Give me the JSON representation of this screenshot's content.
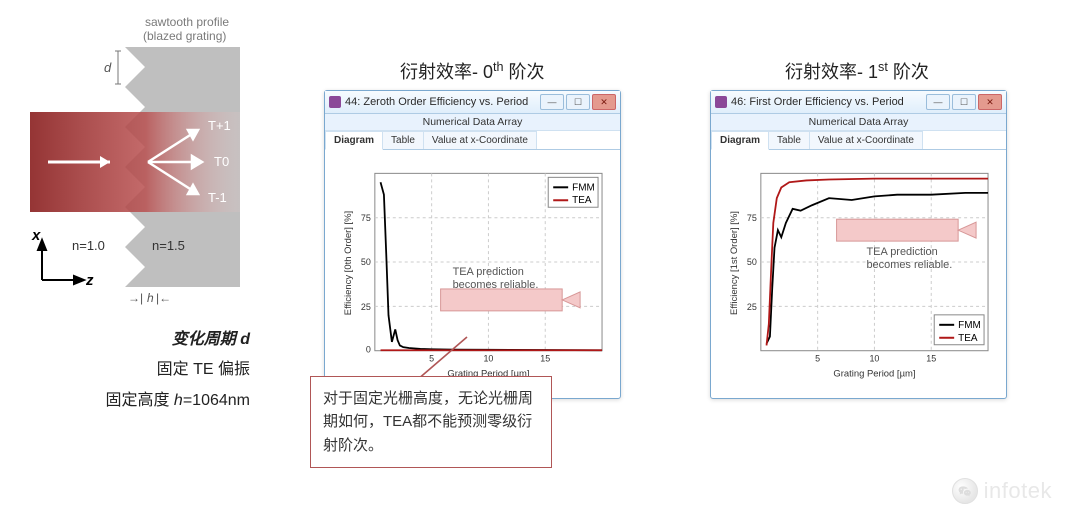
{
  "diagram": {
    "profile_label": "sawtooth profile\n(blazed grating)",
    "d": "d",
    "h": "h",
    "orders": {
      "plus": "T+1",
      "zero": "T0",
      "minus": "T-1"
    },
    "n_in": "n=1.0",
    "n_out": "n=1.5",
    "axes": {
      "x": "x",
      "z": "z"
    },
    "caption_line1_prefix": "变化周期 ",
    "caption_line1_em": "d",
    "caption_line2": "固定 TE 偏振",
    "caption_line3_prefix": "固定高度 ",
    "caption_line3_em": "h",
    "caption_line3_rest": "=1064nm"
  },
  "figure_titles": {
    "left_prefix": "衍射效率- 0",
    "left_sup": "th",
    "left_suffix": " 阶次",
    "right_prefix": "衍射效率- 1",
    "right_sup": "st",
    "right_suffix": " 阶次"
  },
  "windows": {
    "left": {
      "title": "44: Zeroth Order Efficiency vs. Period",
      "subtitle": "Numerical Data Array",
      "tabs": [
        "Diagram",
        "Table",
        "Value at x-Coordinate"
      ],
      "legend": [
        "FMM",
        "TEA"
      ],
      "ylabel": "Efficiency [0th Order] [%]",
      "xlabel": "Grating Period [µm]",
      "annotation": "TEA prediction becomes reliable."
    },
    "right": {
      "title": "46: First Order Efficiency vs. Period",
      "subtitle": "Numerical Data Array",
      "tabs": [
        "Diagram",
        "Table",
        "Value at x-Coordinate"
      ],
      "legend": [
        "FMM",
        "TEA"
      ],
      "ylabel": "Efficiency [1st Order] [%]",
      "xlabel": "Grating Period [µm]",
      "annotation": "TEA prediction becomes reliable."
    }
  },
  "callout": "对于固定光栅高度，无论光栅周期如何，TEA都不能预测零级衍射阶次。",
  "watermark": "infotek",
  "chart_data": [
    {
      "type": "line",
      "title": "Zeroth Order Efficiency vs. Period",
      "xlabel": "Grating Period [µm]",
      "ylabel": "Efficiency [0th Order] [%]",
      "xlim": [
        0,
        20
      ],
      "ylim": [
        0,
        100
      ],
      "xticks": [
        5,
        10,
        15
      ],
      "yticks": [
        0,
        25,
        50,
        75
      ],
      "series": [
        {
          "name": "FMM",
          "color": "#000000",
          "x": [
            0.5,
            0.8,
            1.0,
            1.2,
            1.5,
            1.8,
            2.0,
            2.2,
            2.5,
            3.0,
            4.0,
            5.0,
            7.0,
            10.0,
            15.0,
            20.0
          ],
          "y": [
            95,
            88,
            55,
            20,
            5,
            12,
            6,
            3,
            2,
            1.5,
            1.0,
            0.8,
            0.6,
            0.5,
            0.4,
            0.3
          ]
        },
        {
          "name": "TEA",
          "color": "#b01818",
          "x": [
            0.5,
            1.0,
            2.0,
            5.0,
            10.0,
            15.0,
            20.0
          ],
          "y": [
            0.3,
            0.3,
            0.3,
            0.3,
            0.3,
            0.3,
            0.3
          ]
        }
      ]
    },
    {
      "type": "line",
      "title": "First Order Efficiency vs. Period",
      "xlabel": "Grating Period [µm]",
      "ylabel": "Efficiency [1st Order] [%]",
      "xlim": [
        0,
        20
      ],
      "ylim": [
        0,
        100
      ],
      "xticks": [
        5,
        10,
        15
      ],
      "yticks": [
        25,
        50,
        75
      ],
      "series": [
        {
          "name": "FMM",
          "color": "#000000",
          "x": [
            0.5,
            0.8,
            1.0,
            1.2,
            1.5,
            1.8,
            2.2,
            2.8,
            3.5,
            4.5,
            6.0,
            8.0,
            10.0,
            12.0,
            15.0,
            18.0,
            20.0
          ],
          "y": [
            4,
            8,
            35,
            58,
            68,
            64,
            72,
            80,
            79,
            82,
            86,
            85,
            87,
            88,
            88,
            89,
            89
          ]
        },
        {
          "name": "TEA",
          "color": "#b01818",
          "x": [
            0.5,
            0.7,
            0.9,
            1.1,
            1.4,
            1.8,
            2.5,
            4.0,
            6.0,
            10.0,
            15.0,
            20.0
          ],
          "y": [
            3,
            15,
            45,
            72,
            86,
            92,
            95,
            96,
            96.5,
            97,
            97,
            97
          ]
        }
      ]
    }
  ]
}
